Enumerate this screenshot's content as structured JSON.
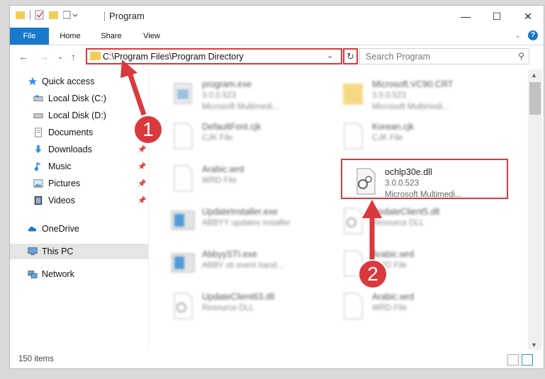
{
  "window": {
    "title": "Program",
    "controls": [
      "minimize",
      "maximize",
      "close"
    ]
  },
  "ribbon": {
    "tabs": [
      "File",
      "Home",
      "Share",
      "View"
    ]
  },
  "address_bar": {
    "path": "C:\\Program Files\\Program Directory",
    "search_placeholder": "Search Program"
  },
  "sidebar": {
    "items": [
      {
        "label": "Quick access",
        "icon": "star-icon"
      },
      {
        "label": "Local Disk (C:)",
        "icon": "drive-icon"
      },
      {
        "label": "Local Disk (D:)",
        "icon": "drive-icon"
      },
      {
        "label": "Documents",
        "icon": "documents-icon"
      },
      {
        "label": "Downloads",
        "icon": "download-icon",
        "pinned": true
      },
      {
        "label": "Music",
        "icon": "music-icon",
        "pinned": true
      },
      {
        "label": "Pictures",
        "icon": "pictures-icon",
        "pinned": true
      },
      {
        "label": "Videos",
        "icon": "videos-icon",
        "pinned": true
      },
      {
        "label": "OneDrive",
        "icon": "cloud-icon"
      },
      {
        "label": "This PC",
        "icon": "computer-icon",
        "selected": true
      },
      {
        "label": "Network",
        "icon": "network-icon"
      }
    ]
  },
  "files": [
    {
      "name": "program.exe",
      "line1": "3.0.0.523",
      "line2": "Microsoft Multimedi...",
      "icon": "exe-icon"
    },
    {
      "name": "Microsoft.VC90.CRT",
      "line1": "3.0.0.523",
      "line2": "Microsoft Multimedi...",
      "icon": "folder-icon"
    },
    {
      "name": "DefaultFont.cjk",
      "line1": "CJK File",
      "line2": "",
      "icon": "blank-file-icon"
    },
    {
      "name": "Korean.cjk",
      "line1": "CJK File",
      "line2": "",
      "icon": "blank-file-icon"
    },
    {
      "name": "Arabic.wrd",
      "line1": "WRD File",
      "line2": "",
      "icon": "blank-file-icon"
    },
    {
      "name": "ochlp30e.dll",
      "line1": "3.0.0.523",
      "line2": "Microsoft Multimedi...",
      "icon": "dll-gear-icon",
      "highlighted": true
    },
    {
      "name": "UpdateInstaller.exe",
      "line1": "ABBYY updates installer",
      "line2": "",
      "icon": "installer-icon"
    },
    {
      "name": "UpdateClient5.dll",
      "line1": "Resource DLL",
      "line2": "",
      "icon": "dll-gear-icon"
    },
    {
      "name": "AbbyySTI.exe",
      "line1": "ABBY sti event hand...",
      "line2": "",
      "icon": "installer-icon"
    },
    {
      "name": "Arabic.wrd",
      "line1": "WRD File",
      "line2": "",
      "icon": "blank-file-icon"
    },
    {
      "name": "UpdateClient63.dll",
      "line1": "Resource DLL",
      "line2": "",
      "icon": "dll-gear-icon"
    },
    {
      "name": "Arabic.wrd",
      "line1": "WRD File",
      "line2": "",
      "icon": "blank-file-icon"
    }
  ],
  "status": {
    "item_count": "150 items"
  },
  "annotations": {
    "marker1": "1",
    "marker2": "2"
  },
  "colors": {
    "accent": "#1979ca",
    "highlight": "#d9393e",
    "folder": "#f2cd5b"
  }
}
